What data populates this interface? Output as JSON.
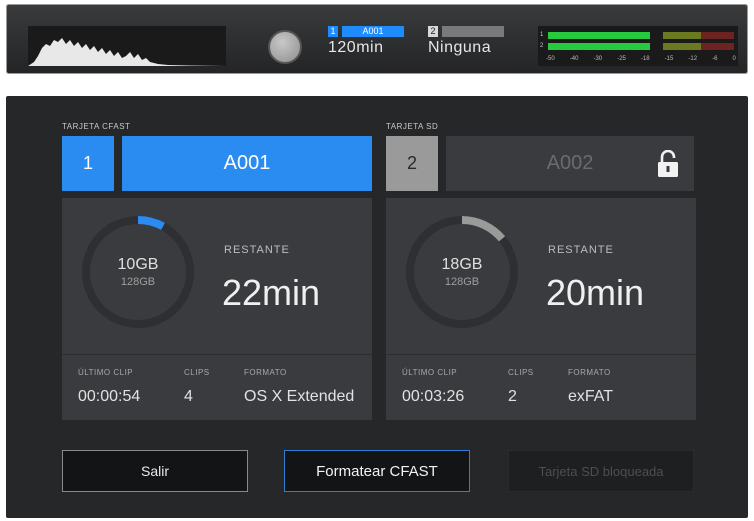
{
  "topbar": {
    "slot1": {
      "number": "1",
      "clip_name": "A001",
      "remaining": "120min"
    },
    "slot2": {
      "number": "2",
      "clip_name": "",
      "remaining": "Ninguna"
    },
    "meter_channels": [
      "1",
      "2"
    ],
    "meter_scale": [
      "-50",
      "-40",
      "-30",
      "-25",
      "-18",
      "-15",
      "-12",
      "-6",
      "0"
    ],
    "meter_levels": [
      0.55,
      0.55
    ]
  },
  "cfast": {
    "title": "TARJETA CFAST",
    "slot_number": "1",
    "name": "A001",
    "used": "10GB",
    "total": "128GB",
    "used_fraction": 0.08,
    "remaining_label": "RESTANTE",
    "remaining_value": "22min",
    "last_clip_label": "ÚLTIMO CLIP",
    "last_clip_value": "00:00:54",
    "clips_label": "CLIPS",
    "clips_value": "4",
    "format_label": "FORMATO",
    "format_value": "OS X Extended"
  },
  "sd": {
    "title": "TARJETA SD",
    "slot_number": "2",
    "name": "A002",
    "used": "18GB",
    "total": "128GB",
    "used_fraction": 0.14,
    "remaining_label": "RESTANTE",
    "remaining_value": "20min",
    "last_clip_label": "ÚLTIMO CLIP",
    "last_clip_value": "00:03:26",
    "clips_label": "CLIPS",
    "clips_value": "2",
    "format_label": "FORMATO",
    "format_value": "exFAT",
    "lock_icon": "lock-open-icon"
  },
  "buttons": {
    "exit_label": "Salir",
    "format_label": "Formatear CFAST",
    "locked_label": "Tarjeta SD bloqueada"
  },
  "colors": {
    "accent": "#2a8cf0",
    "cfast_arc": "#2a8cf0",
    "sd_arc": "#9a9a9a",
    "panel": "#262729"
  }
}
